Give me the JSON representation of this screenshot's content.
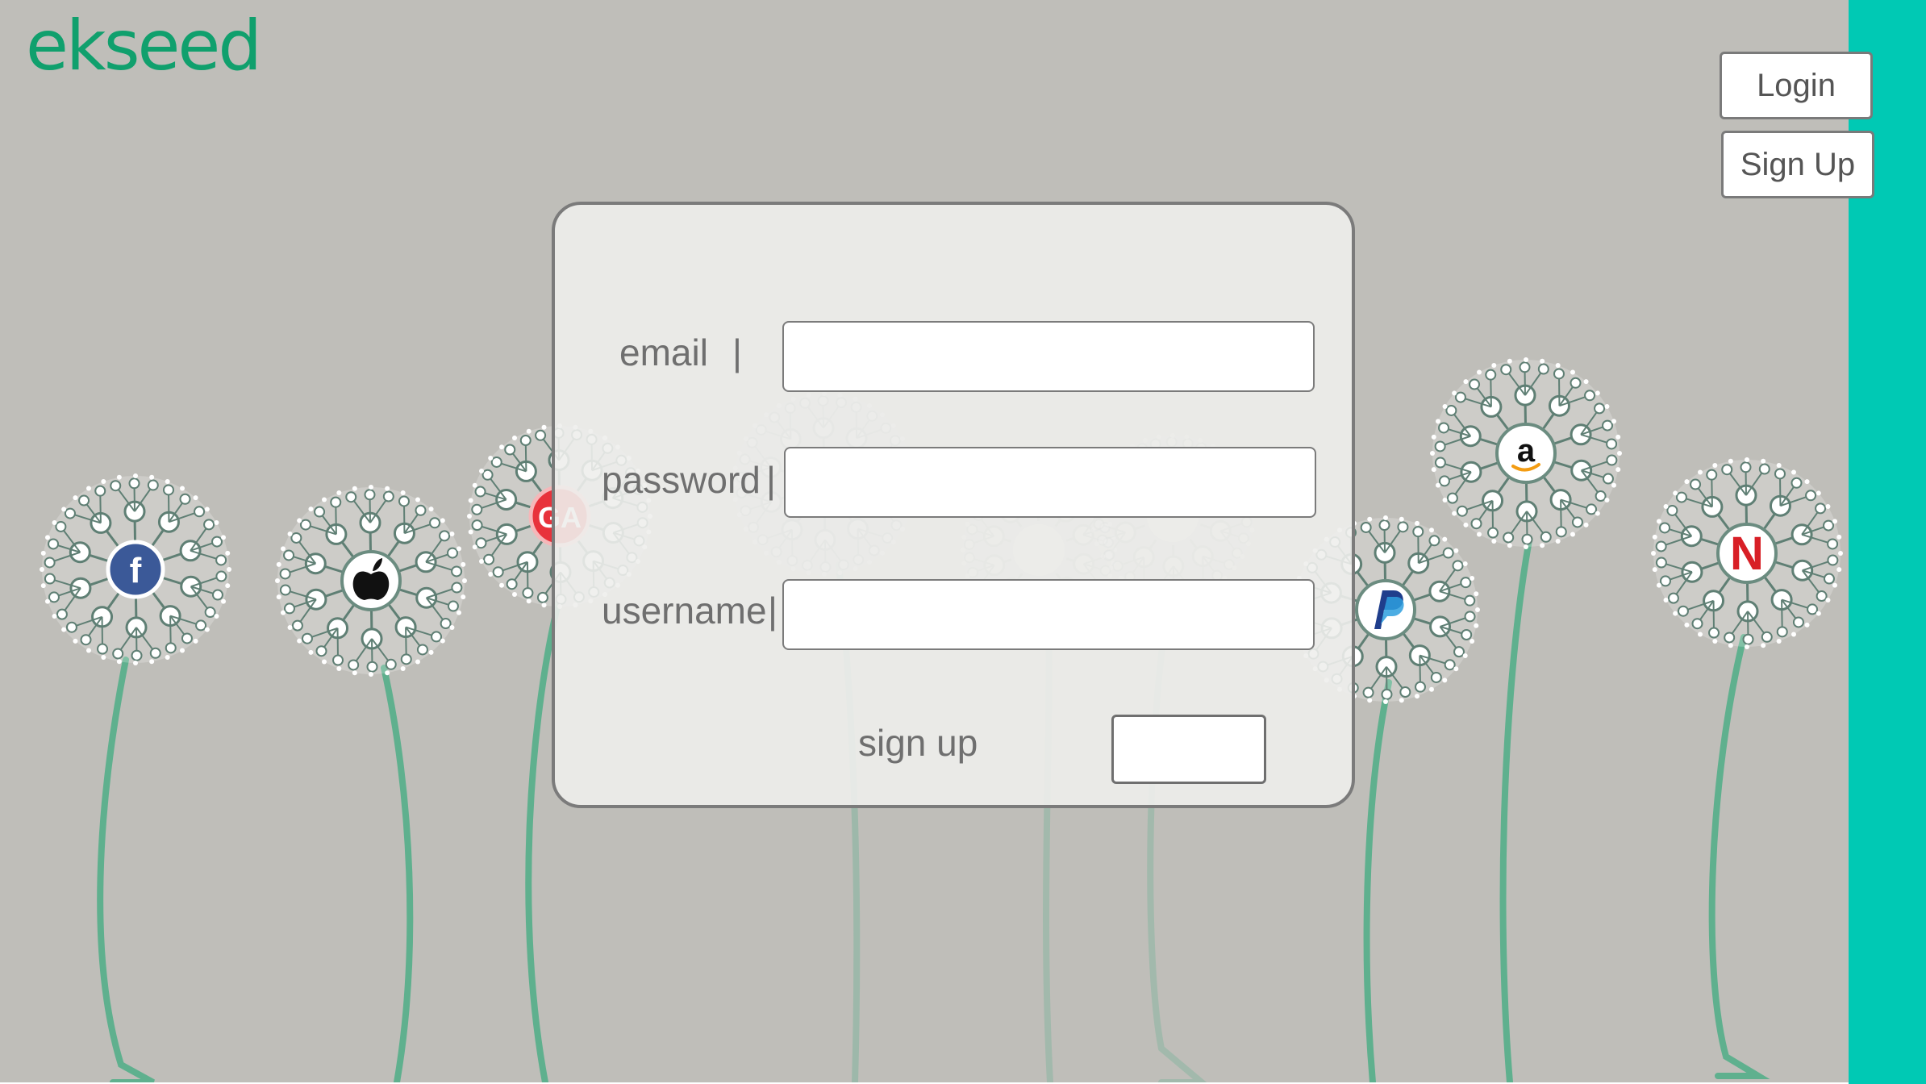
{
  "brand": {
    "logo_text": "ekseed",
    "color": "#10a06d",
    "accent": "#00c9b4"
  },
  "header": {
    "login_label": "Login",
    "signup_label": "Sign Up"
  },
  "form": {
    "email_label": "email",
    "password_label": "password",
    "username_label": "username",
    "separator": "|",
    "email_value": "",
    "password_value": "",
    "username_value": "",
    "submit_label": "sign up"
  },
  "flowers": [
    {
      "id": "facebook",
      "icon": "facebook-icon"
    },
    {
      "id": "apple",
      "icon": "apple-icon"
    },
    {
      "id": "ga",
      "icon": "ga-badge-icon"
    },
    {
      "id": "faded-1",
      "icon": "faded-logo-icon"
    },
    {
      "id": "google",
      "icon": "google-icon"
    },
    {
      "id": "nvidia",
      "icon": "nvidia-icon"
    },
    {
      "id": "paypal",
      "icon": "paypal-icon"
    },
    {
      "id": "amazon",
      "icon": "amazon-icon"
    },
    {
      "id": "netflix",
      "icon": "netflix-icon"
    }
  ]
}
